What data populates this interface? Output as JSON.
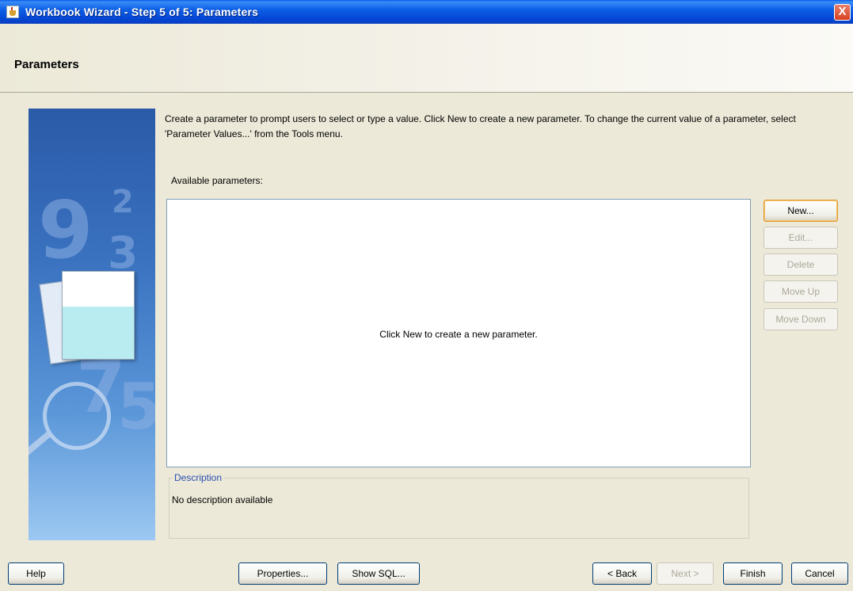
{
  "window": {
    "title": "Workbook Wizard - Step 5 of 5: Parameters",
    "close_label": "X"
  },
  "header": {
    "title": "Parameters"
  },
  "instructions": "Create a parameter to prompt users to select or type a value. Click New to create a new parameter. To change the current value of a parameter, select 'Parameter Values...' from the Tools menu.",
  "parameters": {
    "label": "Available parameters:",
    "empty_message": "Click New to create a new parameter.",
    "items": []
  },
  "side_buttons": {
    "new": "New...",
    "edit": "Edit...",
    "delete": "Delete",
    "move_up": "Move Up",
    "move_down": "Move Down"
  },
  "description": {
    "legend": "Description",
    "text": "No description available"
  },
  "footer": {
    "help": "Help",
    "properties": "Properties...",
    "show_sql": "Show SQL...",
    "back": "< Back",
    "next": "Next >",
    "finish": "Finish",
    "cancel": "Cancel"
  },
  "side_image": {
    "numbers": [
      "9",
      "2",
      "3",
      "7",
      "5"
    ]
  },
  "colors": {
    "titlebar": "#0d5fe6",
    "dialog_bg": "#ece9d8",
    "default_button_border": "#e09a30",
    "legend_text": "#2a4fb4"
  },
  "icons": {
    "app": "java-cup-icon",
    "close": "close-icon"
  }
}
